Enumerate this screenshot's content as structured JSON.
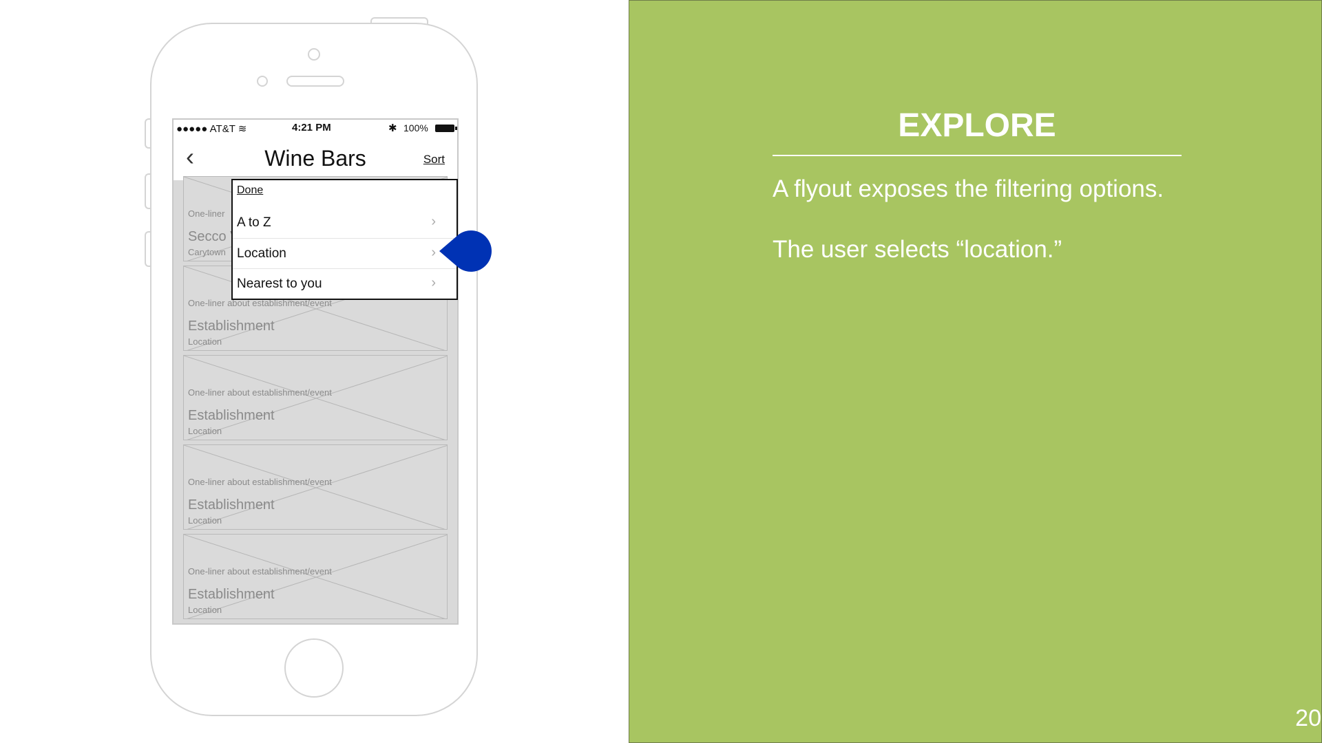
{
  "phone": {
    "status": {
      "carrier": "●●●●● AT&T ≋",
      "time": "4:21 PM",
      "bluetooth": "✱",
      "battery": "100%"
    },
    "nav": {
      "back": "‹",
      "title": "Wine Bars",
      "sort": "Sort"
    },
    "cards": [
      {
        "oneliner": "One-liner",
        "title": "Secco V",
        "location": "Carytown"
      },
      {
        "oneliner": "One-liner about establishment/event",
        "title": "Establishment",
        "location": "Location"
      },
      {
        "oneliner": "One-liner about establishment/event",
        "title": "Establishment",
        "location": "Location"
      },
      {
        "oneliner": "One-liner about establishment/event",
        "title": "Establishment",
        "location": "Location"
      },
      {
        "oneliner": "One-liner about establishment/event",
        "title": "Establishment",
        "location": "Location"
      }
    ],
    "flyout": {
      "done": "Done",
      "items": [
        {
          "label": "A to Z",
          "chevron": "›"
        },
        {
          "label": "Location",
          "chevron": "›"
        },
        {
          "label": "Nearest to you",
          "chevron": "›"
        }
      ]
    },
    "touch_color": "#0032b4"
  },
  "panel": {
    "heading": "EXPLORE",
    "line1": "A flyout exposes the filtering options.",
    "line2": "The user selects “location.”",
    "page_number": "20",
    "background": "#a8c561"
  }
}
